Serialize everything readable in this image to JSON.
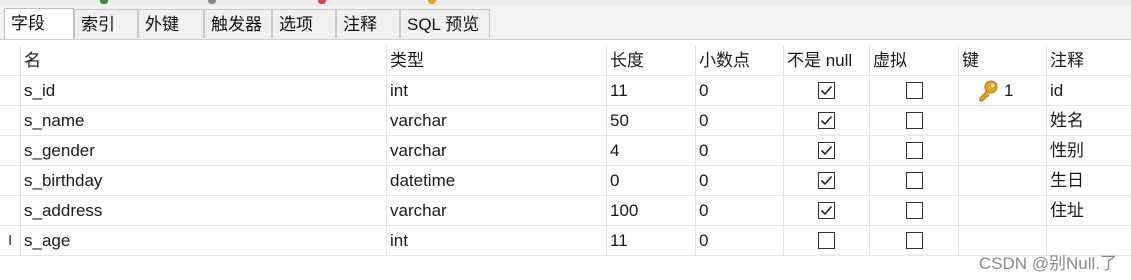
{
  "tabs": [
    {
      "label": "字段",
      "active": true
    },
    {
      "label": "索引",
      "active": false
    },
    {
      "label": "外键",
      "active": false
    },
    {
      "label": "触发器",
      "active": false
    },
    {
      "label": "选项",
      "active": false
    },
    {
      "label": "注释",
      "active": false
    },
    {
      "label": "SQL 预览",
      "active": false
    }
  ],
  "columns": [
    "名",
    "类型",
    "长度",
    "小数点",
    "不是 null",
    "虚拟",
    "键",
    "注释"
  ],
  "rows": [
    {
      "name": "s_id",
      "type": "int",
      "length": "11",
      "decimals": "0",
      "not_null": true,
      "virtual": false,
      "key": "1",
      "comment": "id"
    },
    {
      "name": "s_name",
      "type": "varchar",
      "length": "50",
      "decimals": "0",
      "not_null": true,
      "virtual": false,
      "key": "",
      "comment": "姓名"
    },
    {
      "name": "s_gender",
      "type": "varchar",
      "length": "4",
      "decimals": "0",
      "not_null": true,
      "virtual": false,
      "key": "",
      "comment": "性别"
    },
    {
      "name": "s_birthday",
      "type": "datetime",
      "length": "0",
      "decimals": "0",
      "not_null": true,
      "virtual": false,
      "key": "",
      "comment": "生日"
    },
    {
      "name": "s_address",
      "type": "varchar",
      "length": "100",
      "decimals": "0",
      "not_null": true,
      "virtual": false,
      "key": "",
      "comment": "住址"
    },
    {
      "name": "s_age",
      "type": "int",
      "length": "11",
      "decimals": "0",
      "not_null": false,
      "virtual": false,
      "key": "",
      "comment": ""
    }
  ],
  "current_row_indicator": "I",
  "key_icon": "key-icon",
  "watermark": "CSDN @别Null.了",
  "colors": {
    "key_gold": "#e8a317",
    "grid_line": "#e4e4e4",
    "tab_bg": "#f0f0f0"
  }
}
